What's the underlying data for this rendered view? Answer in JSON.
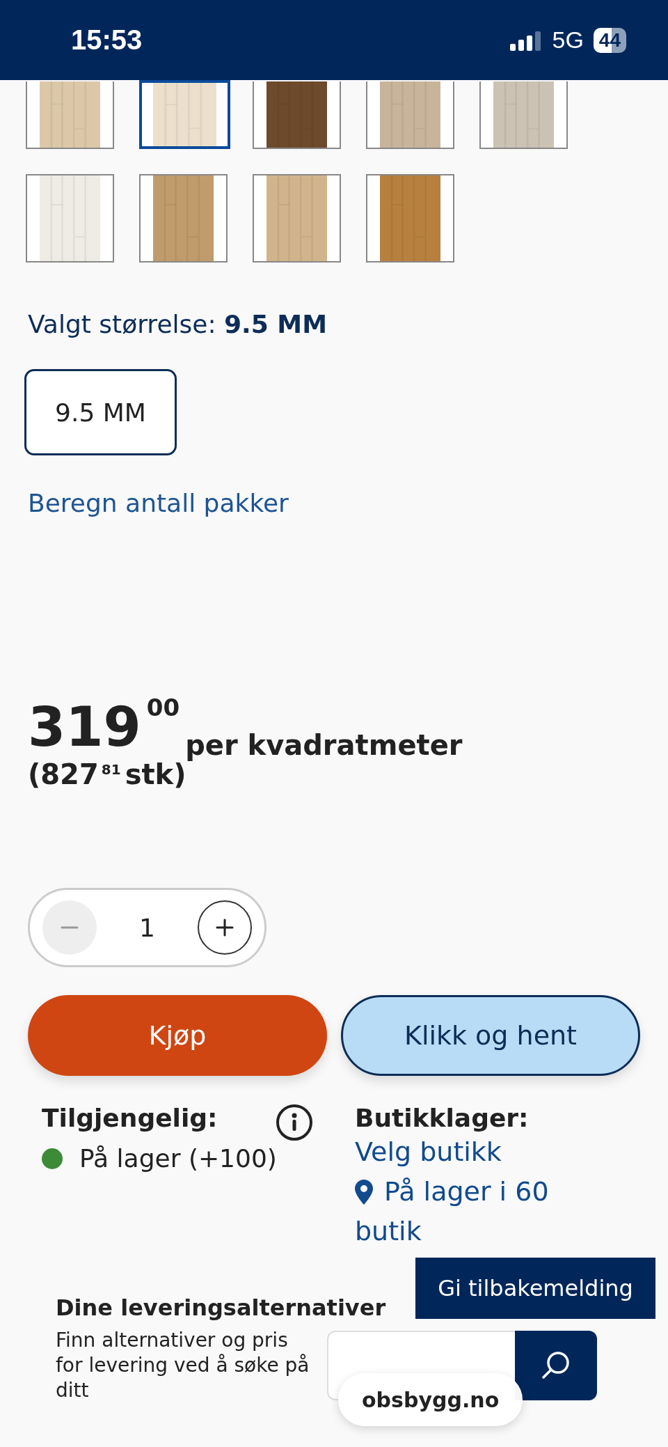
{
  "status_bar": {
    "time": "15:53",
    "network": "5G",
    "battery": "44"
  },
  "swatches": [
    {
      "kind": "picture",
      "color": "#dcc8a8",
      "selected": false
    },
    {
      "kind": "picture",
      "color": "#ece0cc",
      "selected": true
    },
    {
      "kind": "picture",
      "color": "#6e4a2c",
      "selected": false
    },
    {
      "kind": "picture",
      "color": "#c8b49a",
      "selected": false
    },
    {
      "kind": "picture",
      "color": "#cbc2b4",
      "selected": false
    },
    {
      "kind": "picture",
      "color": "#eeece4",
      "selected": false
    },
    {
      "kind": "picture",
      "color": "#c09c6c",
      "selected": false
    },
    {
      "kind": "picture",
      "color": "#d2b48c",
      "selected": false
    },
    {
      "kind": "picture",
      "color": "#b8803e",
      "selected": false
    }
  ],
  "size": {
    "label": "Valgt størrelse:",
    "value": "9.5 MM",
    "options": [
      {
        "label": "9.5 MM",
        "selected": true
      }
    ]
  },
  "calculate_link": "Beregn antall pakker",
  "price": {
    "whole": "319",
    "cents": "00",
    "unit": "per kvadratmeter",
    "package_open": "(827",
    "package_cents": "81",
    "package_close": "stk)"
  },
  "quantity": {
    "value": "1",
    "minus_disabled": true
  },
  "buttons": {
    "buy": "Kjøp",
    "click_collect": "Klikk og hent"
  },
  "availability": {
    "title": "Tilgjengelig:",
    "status": "På lager (+100)",
    "color": "#3d8b37"
  },
  "store_stock": {
    "title": "Butikklager:",
    "link": "Velg butikk",
    "stock": "På lager i 60",
    "stock_tail": "butik"
  },
  "feedback_button": "Gi tilbakemelding",
  "delivery": {
    "title": "Dine leveringsalternativer",
    "text": "Finn alternativer og pris for levering ved å søke på ditt"
  },
  "browser_url": "obsbygg.no"
}
